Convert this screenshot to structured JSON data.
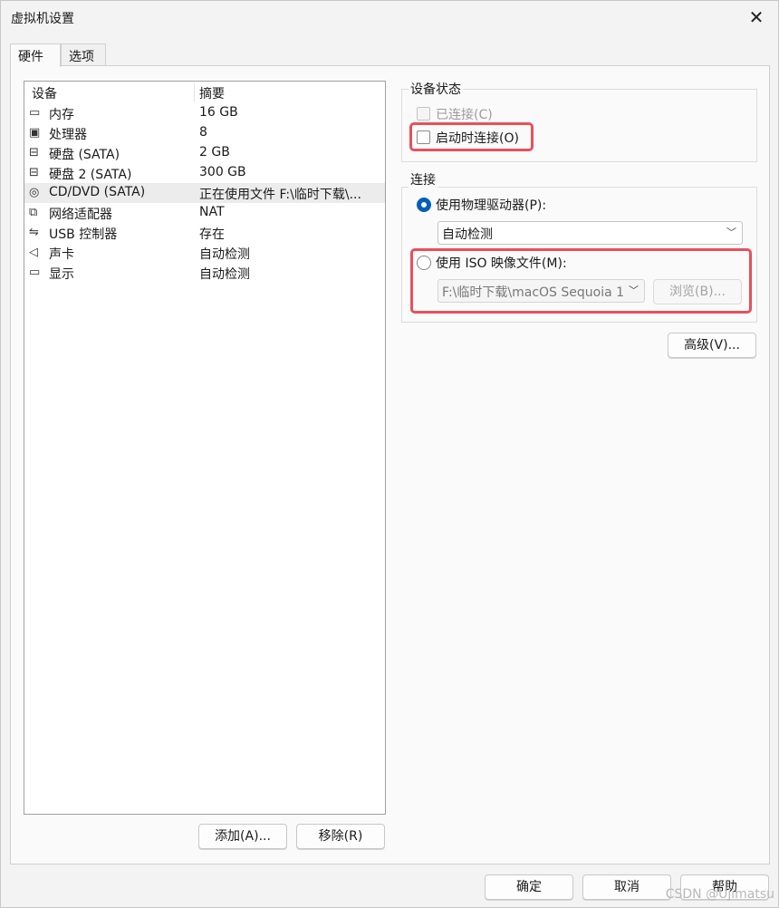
{
  "window": {
    "title": "虚拟机设置",
    "close_glyph": "✕"
  },
  "tabs": [
    {
      "label": "硬件",
      "active": true
    },
    {
      "label": "选项",
      "active": false
    }
  ],
  "device_list": {
    "headers": {
      "device": "设备",
      "summary": "摘要"
    },
    "rows": [
      {
        "icon": "memory-icon",
        "glyph": "▭",
        "device": "内存",
        "summary": "16 GB"
      },
      {
        "icon": "cpu-icon",
        "glyph": "▣",
        "device": "处理器",
        "summary": "8"
      },
      {
        "icon": "hard-disk-icon",
        "glyph": "⊟",
        "device": "硬盘 (SATA)",
        "summary": "2 GB"
      },
      {
        "icon": "hard-disk-icon",
        "glyph": "⊟",
        "device": "硬盘 2 (SATA)",
        "summary": "300 GB"
      },
      {
        "icon": "cd-dvd-icon",
        "glyph": "◎",
        "device": "CD/DVD (SATA)",
        "summary": "正在使用文件 F:\\临时下载\\...",
        "selected": true
      },
      {
        "icon": "network-adapter-icon",
        "glyph": "⧉",
        "device": "网络适配器",
        "summary": "NAT"
      },
      {
        "icon": "usb-icon",
        "glyph": "⇋",
        "device": "USB 控制器",
        "summary": "存在"
      },
      {
        "icon": "sound-card-icon",
        "glyph": "◁",
        "device": "声卡",
        "summary": "自动检测"
      },
      {
        "icon": "display-icon",
        "glyph": "▭",
        "device": "显示",
        "summary": "自动检测"
      }
    ]
  },
  "list_buttons": {
    "add": "添加(A)...",
    "remove": "移除(R)"
  },
  "device_status": {
    "label": "设备状态",
    "connected": {
      "label": "已连接(C)",
      "checked": false,
      "enabled": false
    },
    "connect_on_power_on": {
      "label": "启动时连接(O)",
      "checked": false,
      "enabled": true
    }
  },
  "connection": {
    "label": "连接",
    "physical_drive": {
      "label": "使用物理驱动器(P):",
      "selected": true,
      "dropdown_value": "自动检测"
    },
    "iso_image": {
      "label": "使用 ISO 映像文件(M):",
      "selected": false,
      "path_value": "F:\\临时下载\\macOS Sequoia 1",
      "browse_label": "浏览(B)..."
    }
  },
  "advanced_label": "高级(V)...",
  "dialog_buttons": {
    "ok": "确定",
    "cancel": "取消",
    "help": "帮助"
  },
  "watermark": "CSDN @Ujimatsu",
  "colors": {
    "highlight": "#e8505b",
    "accent": "#005fb8"
  }
}
